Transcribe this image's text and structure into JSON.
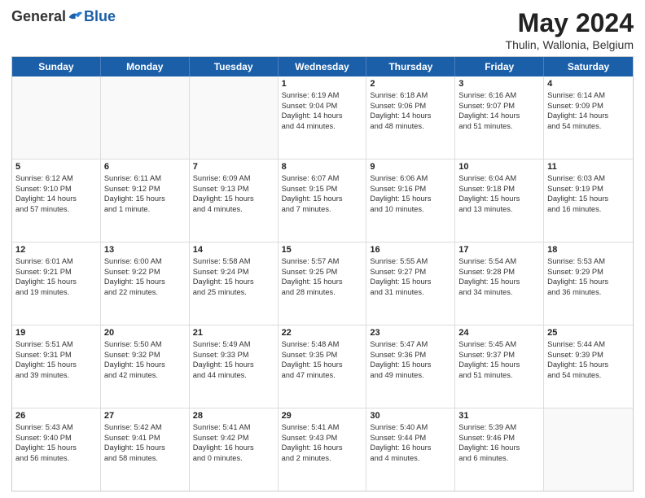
{
  "logo": {
    "general": "General",
    "blue": "Blue"
  },
  "header": {
    "month": "May 2024",
    "location": "Thulin, Wallonia, Belgium"
  },
  "weekdays": [
    "Sunday",
    "Monday",
    "Tuesday",
    "Wednesday",
    "Thursday",
    "Friday",
    "Saturday"
  ],
  "rows": [
    [
      {
        "day": "",
        "lines": []
      },
      {
        "day": "",
        "lines": []
      },
      {
        "day": "",
        "lines": []
      },
      {
        "day": "1",
        "lines": [
          "Sunrise: 6:19 AM",
          "Sunset: 9:04 PM",
          "Daylight: 14 hours",
          "and 44 minutes."
        ]
      },
      {
        "day": "2",
        "lines": [
          "Sunrise: 6:18 AM",
          "Sunset: 9:06 PM",
          "Daylight: 14 hours",
          "and 48 minutes."
        ]
      },
      {
        "day": "3",
        "lines": [
          "Sunrise: 6:16 AM",
          "Sunset: 9:07 PM",
          "Daylight: 14 hours",
          "and 51 minutes."
        ]
      },
      {
        "day": "4",
        "lines": [
          "Sunrise: 6:14 AM",
          "Sunset: 9:09 PM",
          "Daylight: 14 hours",
          "and 54 minutes."
        ]
      }
    ],
    [
      {
        "day": "5",
        "lines": [
          "Sunrise: 6:12 AM",
          "Sunset: 9:10 PM",
          "Daylight: 14 hours",
          "and 57 minutes."
        ]
      },
      {
        "day": "6",
        "lines": [
          "Sunrise: 6:11 AM",
          "Sunset: 9:12 PM",
          "Daylight: 15 hours",
          "and 1 minute."
        ]
      },
      {
        "day": "7",
        "lines": [
          "Sunrise: 6:09 AM",
          "Sunset: 9:13 PM",
          "Daylight: 15 hours",
          "and 4 minutes."
        ]
      },
      {
        "day": "8",
        "lines": [
          "Sunrise: 6:07 AM",
          "Sunset: 9:15 PM",
          "Daylight: 15 hours",
          "and 7 minutes."
        ]
      },
      {
        "day": "9",
        "lines": [
          "Sunrise: 6:06 AM",
          "Sunset: 9:16 PM",
          "Daylight: 15 hours",
          "and 10 minutes."
        ]
      },
      {
        "day": "10",
        "lines": [
          "Sunrise: 6:04 AM",
          "Sunset: 9:18 PM",
          "Daylight: 15 hours",
          "and 13 minutes."
        ]
      },
      {
        "day": "11",
        "lines": [
          "Sunrise: 6:03 AM",
          "Sunset: 9:19 PM",
          "Daylight: 15 hours",
          "and 16 minutes."
        ]
      }
    ],
    [
      {
        "day": "12",
        "lines": [
          "Sunrise: 6:01 AM",
          "Sunset: 9:21 PM",
          "Daylight: 15 hours",
          "and 19 minutes."
        ]
      },
      {
        "day": "13",
        "lines": [
          "Sunrise: 6:00 AM",
          "Sunset: 9:22 PM",
          "Daylight: 15 hours",
          "and 22 minutes."
        ]
      },
      {
        "day": "14",
        "lines": [
          "Sunrise: 5:58 AM",
          "Sunset: 9:24 PM",
          "Daylight: 15 hours",
          "and 25 minutes."
        ]
      },
      {
        "day": "15",
        "lines": [
          "Sunrise: 5:57 AM",
          "Sunset: 9:25 PM",
          "Daylight: 15 hours",
          "and 28 minutes."
        ]
      },
      {
        "day": "16",
        "lines": [
          "Sunrise: 5:55 AM",
          "Sunset: 9:27 PM",
          "Daylight: 15 hours",
          "and 31 minutes."
        ]
      },
      {
        "day": "17",
        "lines": [
          "Sunrise: 5:54 AM",
          "Sunset: 9:28 PM",
          "Daylight: 15 hours",
          "and 34 minutes."
        ]
      },
      {
        "day": "18",
        "lines": [
          "Sunrise: 5:53 AM",
          "Sunset: 9:29 PM",
          "Daylight: 15 hours",
          "and 36 minutes."
        ]
      }
    ],
    [
      {
        "day": "19",
        "lines": [
          "Sunrise: 5:51 AM",
          "Sunset: 9:31 PM",
          "Daylight: 15 hours",
          "and 39 minutes."
        ]
      },
      {
        "day": "20",
        "lines": [
          "Sunrise: 5:50 AM",
          "Sunset: 9:32 PM",
          "Daylight: 15 hours",
          "and 42 minutes."
        ]
      },
      {
        "day": "21",
        "lines": [
          "Sunrise: 5:49 AM",
          "Sunset: 9:33 PM",
          "Daylight: 15 hours",
          "and 44 minutes."
        ]
      },
      {
        "day": "22",
        "lines": [
          "Sunrise: 5:48 AM",
          "Sunset: 9:35 PM",
          "Daylight: 15 hours",
          "and 47 minutes."
        ]
      },
      {
        "day": "23",
        "lines": [
          "Sunrise: 5:47 AM",
          "Sunset: 9:36 PM",
          "Daylight: 15 hours",
          "and 49 minutes."
        ]
      },
      {
        "day": "24",
        "lines": [
          "Sunrise: 5:45 AM",
          "Sunset: 9:37 PM",
          "Daylight: 15 hours",
          "and 51 minutes."
        ]
      },
      {
        "day": "25",
        "lines": [
          "Sunrise: 5:44 AM",
          "Sunset: 9:39 PM",
          "Daylight: 15 hours",
          "and 54 minutes."
        ]
      }
    ],
    [
      {
        "day": "26",
        "lines": [
          "Sunrise: 5:43 AM",
          "Sunset: 9:40 PM",
          "Daylight: 15 hours",
          "and 56 minutes."
        ]
      },
      {
        "day": "27",
        "lines": [
          "Sunrise: 5:42 AM",
          "Sunset: 9:41 PM",
          "Daylight: 15 hours",
          "and 58 minutes."
        ]
      },
      {
        "day": "28",
        "lines": [
          "Sunrise: 5:41 AM",
          "Sunset: 9:42 PM",
          "Daylight: 16 hours",
          "and 0 minutes."
        ]
      },
      {
        "day": "29",
        "lines": [
          "Sunrise: 5:41 AM",
          "Sunset: 9:43 PM",
          "Daylight: 16 hours",
          "and 2 minutes."
        ]
      },
      {
        "day": "30",
        "lines": [
          "Sunrise: 5:40 AM",
          "Sunset: 9:44 PM",
          "Daylight: 16 hours",
          "and 4 minutes."
        ]
      },
      {
        "day": "31",
        "lines": [
          "Sunrise: 5:39 AM",
          "Sunset: 9:46 PM",
          "Daylight: 16 hours",
          "and 6 minutes."
        ]
      },
      {
        "day": "",
        "lines": []
      }
    ]
  ]
}
